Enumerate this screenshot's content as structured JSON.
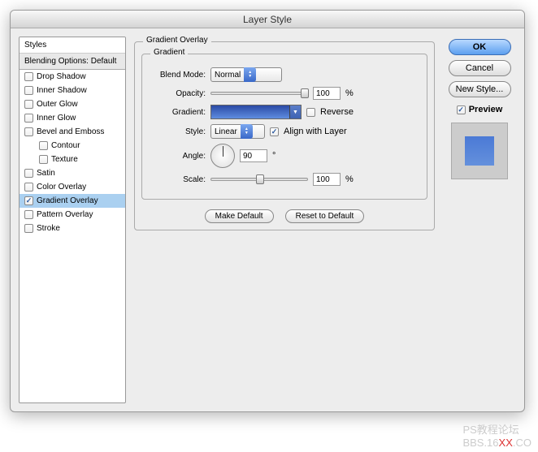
{
  "window": {
    "title": "Layer Style"
  },
  "sidebar": {
    "header1": "Styles",
    "header2": "Blending Options: Default",
    "items": [
      {
        "label": "Drop Shadow",
        "checked": false,
        "indent": false
      },
      {
        "label": "Inner Shadow",
        "checked": false,
        "indent": false
      },
      {
        "label": "Outer Glow",
        "checked": false,
        "indent": false
      },
      {
        "label": "Inner Glow",
        "checked": false,
        "indent": false
      },
      {
        "label": "Bevel and Emboss",
        "checked": false,
        "indent": false
      },
      {
        "label": "Contour",
        "checked": false,
        "indent": true
      },
      {
        "label": "Texture",
        "checked": false,
        "indent": true
      },
      {
        "label": "Satin",
        "checked": false,
        "indent": false
      },
      {
        "label": "Color Overlay",
        "checked": false,
        "indent": false
      },
      {
        "label": "Gradient Overlay",
        "checked": true,
        "indent": false,
        "selected": true
      },
      {
        "label": "Pattern Overlay",
        "checked": false,
        "indent": false
      },
      {
        "label": "Stroke",
        "checked": false,
        "indent": false
      }
    ]
  },
  "panel": {
    "title": "Gradient Overlay",
    "subtitle": "Gradient",
    "blendMode": {
      "label": "Blend Mode:",
      "value": "Normal"
    },
    "opacity": {
      "label": "Opacity:",
      "value": "100",
      "unit": "%"
    },
    "gradient": {
      "label": "Gradient:",
      "reverse_label": "Reverse",
      "reverse_checked": false
    },
    "style": {
      "label": "Style:",
      "value": "Linear",
      "align_label": "Align with Layer",
      "align_checked": true
    },
    "angle": {
      "label": "Angle:",
      "value": "90",
      "unit": "°"
    },
    "scale": {
      "label": "Scale:",
      "value": "100",
      "unit": "%"
    },
    "makeDefault": "Make Default",
    "resetDefault": "Reset to Default"
  },
  "buttons": {
    "ok": "OK",
    "cancel": "Cancel",
    "newStyle": "New Style...",
    "preview": "Preview"
  },
  "watermark": {
    "text1": "PS教程论坛",
    "text2a": "BBS.16",
    "text2b": "XX",
    "text2c": ".CO"
  }
}
